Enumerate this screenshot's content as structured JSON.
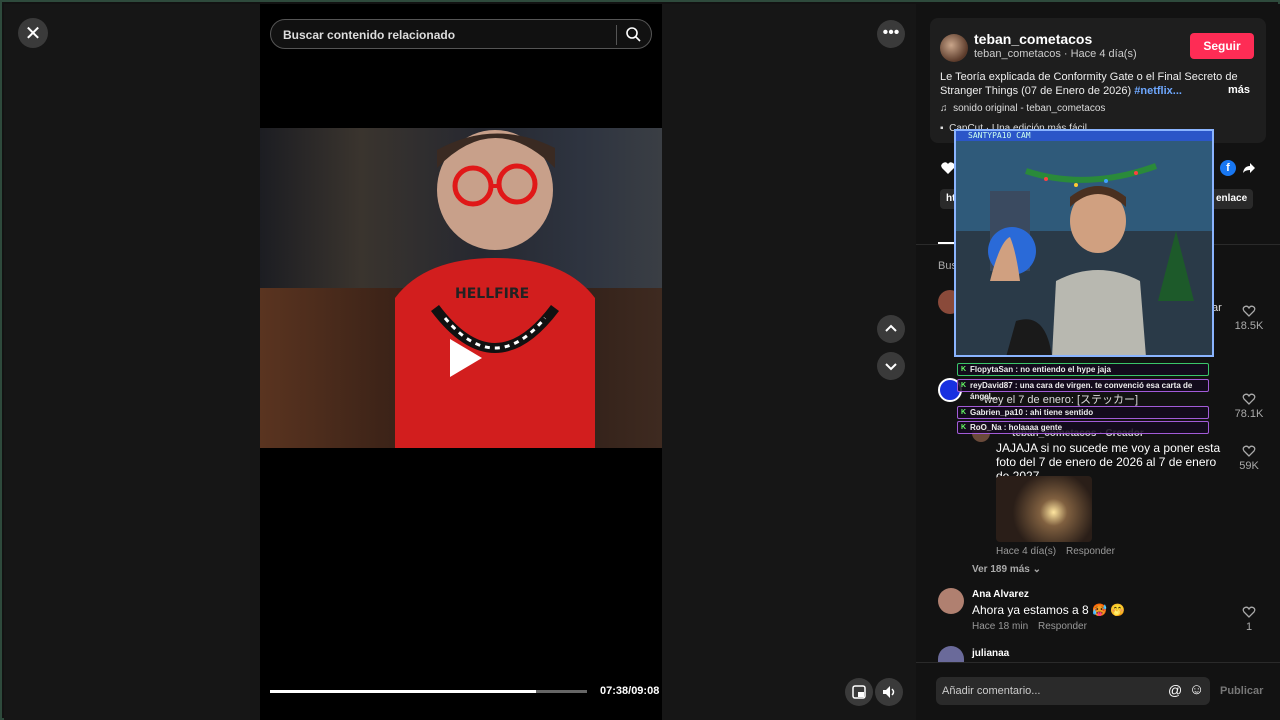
{
  "search": {
    "placeholder": "Buscar contenido relacionado"
  },
  "video": {
    "current_time": "07:38",
    "total_time": "09:08",
    "time_label": "07:38/09:08",
    "progress": 0.84
  },
  "post": {
    "username": "teban_cometacos",
    "meta": "teban_cometacos · Hace 4 día(s)",
    "follow_label": "Seguir",
    "description": "Le Teoría explicada de Conformity Gate o el Final Secreto de Stranger Things (07 de Enero de 2026)",
    "hashtag": "#netflix...",
    "more_label": "más",
    "sound": "sonido original - teban_cometacos",
    "capcut": "CapCut · Una edición más fácil",
    "copy_link_prefix": "htt",
    "copy_link_label": "enlace",
    "tab_partial": "r",
    "search_partial": "Bus"
  },
  "stream_overlay": {
    "cam_title": "SANTYPA10 CAM",
    "chat": [
      {
        "user": "FlopytaSan",
        "text": "FlopytaSan : no entiendo el hype jaja"
      },
      {
        "user": "reyDavid87",
        "text": "reyDavid87 : una cara de virgen. te convenció esa carta de ángel..."
      },
      {
        "user": "Gabrien_pa10",
        "text": "Gabrien_pa10 : ahi tiene sentido"
      },
      {
        "user": "RoO_Na",
        "text": "RoO_Na : holaaaa gente"
      }
    ]
  },
  "comments": [
    {
      "user": "",
      "text": "ar",
      "likes": "18.5K"
    },
    {
      "user": "",
      "text": "wey el 7 de enero: [ステッカー]",
      "likes": "78.1K"
    },
    {
      "user": "teban_cometacos · Creador",
      "text": "JAJAJA si no sucede me voy a poner esta foto del 7 de enero de 2026 al 7 de enero de 2027",
      "time": "Hace 4 día(s)",
      "reply": "Responder",
      "likes": "59K"
    },
    {
      "user": "Ana Alvarez",
      "text": "Ahora ya estamos a 8 🥵 🤭",
      "time": "Hace 18 min",
      "reply": "Responder",
      "likes": "1"
    },
    {
      "user": "julianaa",
      "text": ""
    }
  ],
  "view_more": "Ver 189 más",
  "comment_input": {
    "placeholder": "Añadir comentario...",
    "publish_label": "Publicar"
  },
  "colors": {
    "accent": "#fe2c55",
    "hashtag": "#6ea8ff",
    "frame": "#2e4a3c"
  },
  "icons": [
    "close-icon",
    "search-icon",
    "more-icon",
    "chevron-up-icon",
    "chevron-down-icon",
    "play-icon",
    "pip-icon",
    "volume-icon",
    "heart-icon",
    "music-icon",
    "at-icon",
    "emoji-icon",
    "facebook-icon",
    "share-icon"
  ]
}
